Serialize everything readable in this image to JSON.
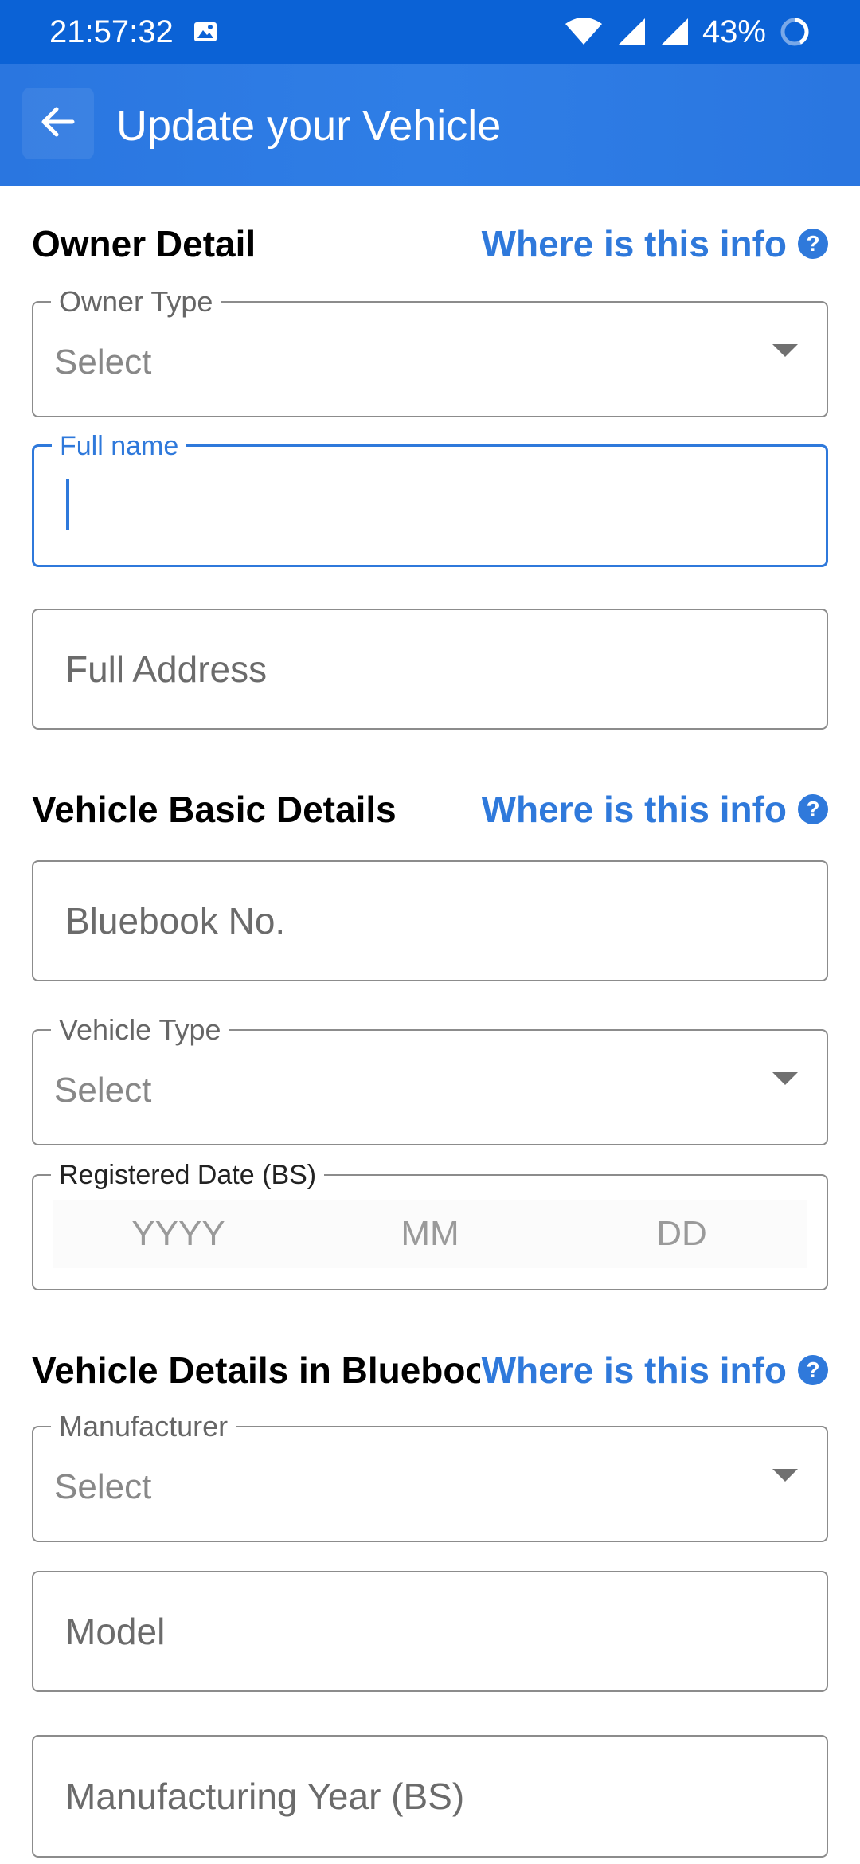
{
  "status_bar": {
    "time": "21:57:32",
    "battery": "43%"
  },
  "app_bar": {
    "title": "Update your Vehicle"
  },
  "sections": {
    "owner": {
      "title": "Owner Detail",
      "info_link": "Where is this info",
      "owner_type_label": "Owner Type",
      "owner_type_value": "Select",
      "full_name_label": "Full name",
      "full_address_placeholder": "Full Address"
    },
    "vehicle_basic": {
      "title": "Vehicle Basic Details",
      "info_link": "Where is this info",
      "bluebook_placeholder": "Bluebook No.",
      "vehicle_type_label": "Vehicle Type",
      "vehicle_type_value": "Select",
      "registered_date_label": "Registered Date (BS)",
      "date_year": "YYYY",
      "date_month": "MM",
      "date_day": "DD"
    },
    "bluebook_details": {
      "title": "Vehicle Details in Bluebook",
      "info_link": "Where is this info",
      "manufacturer_label": "Manufacturer",
      "manufacturer_value": "Select",
      "model_placeholder": "Model",
      "manufacturing_year_placeholder": "Manufacturing Year (BS)"
    }
  },
  "colors": {
    "status_bar": "#0b62d6",
    "app_bar": "#2f7ee6",
    "accent": "#2f79db"
  },
  "icons": {
    "back": "arrow-left-icon",
    "help": "question-circle-icon",
    "dropdown": "caret-down-icon"
  }
}
